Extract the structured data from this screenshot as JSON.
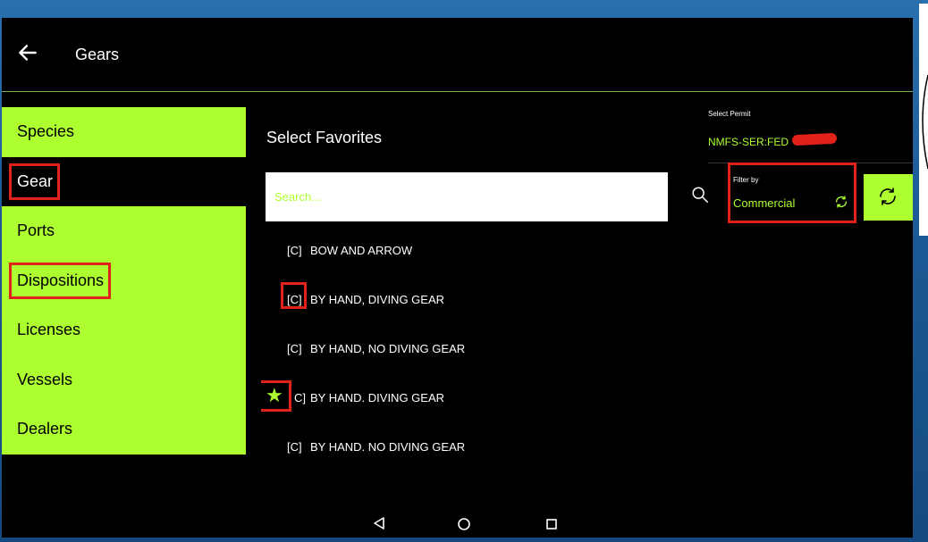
{
  "appbar": {
    "title": "Gears"
  },
  "sidebar": {
    "items": [
      {
        "label": "Species"
      },
      {
        "label": "Gear"
      },
      {
        "label": "Ports"
      },
      {
        "label": "Dispositions"
      },
      {
        "label": "Licenses"
      },
      {
        "label": "Vessels"
      },
      {
        "label": "Dealers"
      }
    ]
  },
  "main": {
    "title": "Select Favorites",
    "search": {
      "placeholder": "Search..."
    },
    "gears": [
      {
        "prefix": "[C]",
        "name": "BOW AND ARROW"
      },
      {
        "prefix": "[C]",
        "name": "BY HAND, DIVING GEAR"
      },
      {
        "prefix": "[C]",
        "name": "BY HAND, NO DIVING GEAR"
      },
      {
        "prefix": "C]",
        "name": "BY HAND. DIVING GEAR",
        "favorite": true
      },
      {
        "prefix": "[C]",
        "name": "BY HAND. NO DIVING GEAR"
      }
    ]
  },
  "permit": {
    "label": "Select Permit",
    "value": "NMFS-SER:FED"
  },
  "filter": {
    "label": "Filter by",
    "value": "Commercial"
  },
  "colors": {
    "accent": "#adff2f",
    "highlight": "#e0221b",
    "background": "#000000"
  },
  "icons": {
    "back": "arrow-left-icon",
    "search": "search-icon",
    "refresh": "refresh-icon",
    "favorite": "star-icon",
    "nav_back": "triangle-back-icon",
    "nav_home": "circle-home-icon",
    "nav_recent": "square-recents-icon"
  }
}
